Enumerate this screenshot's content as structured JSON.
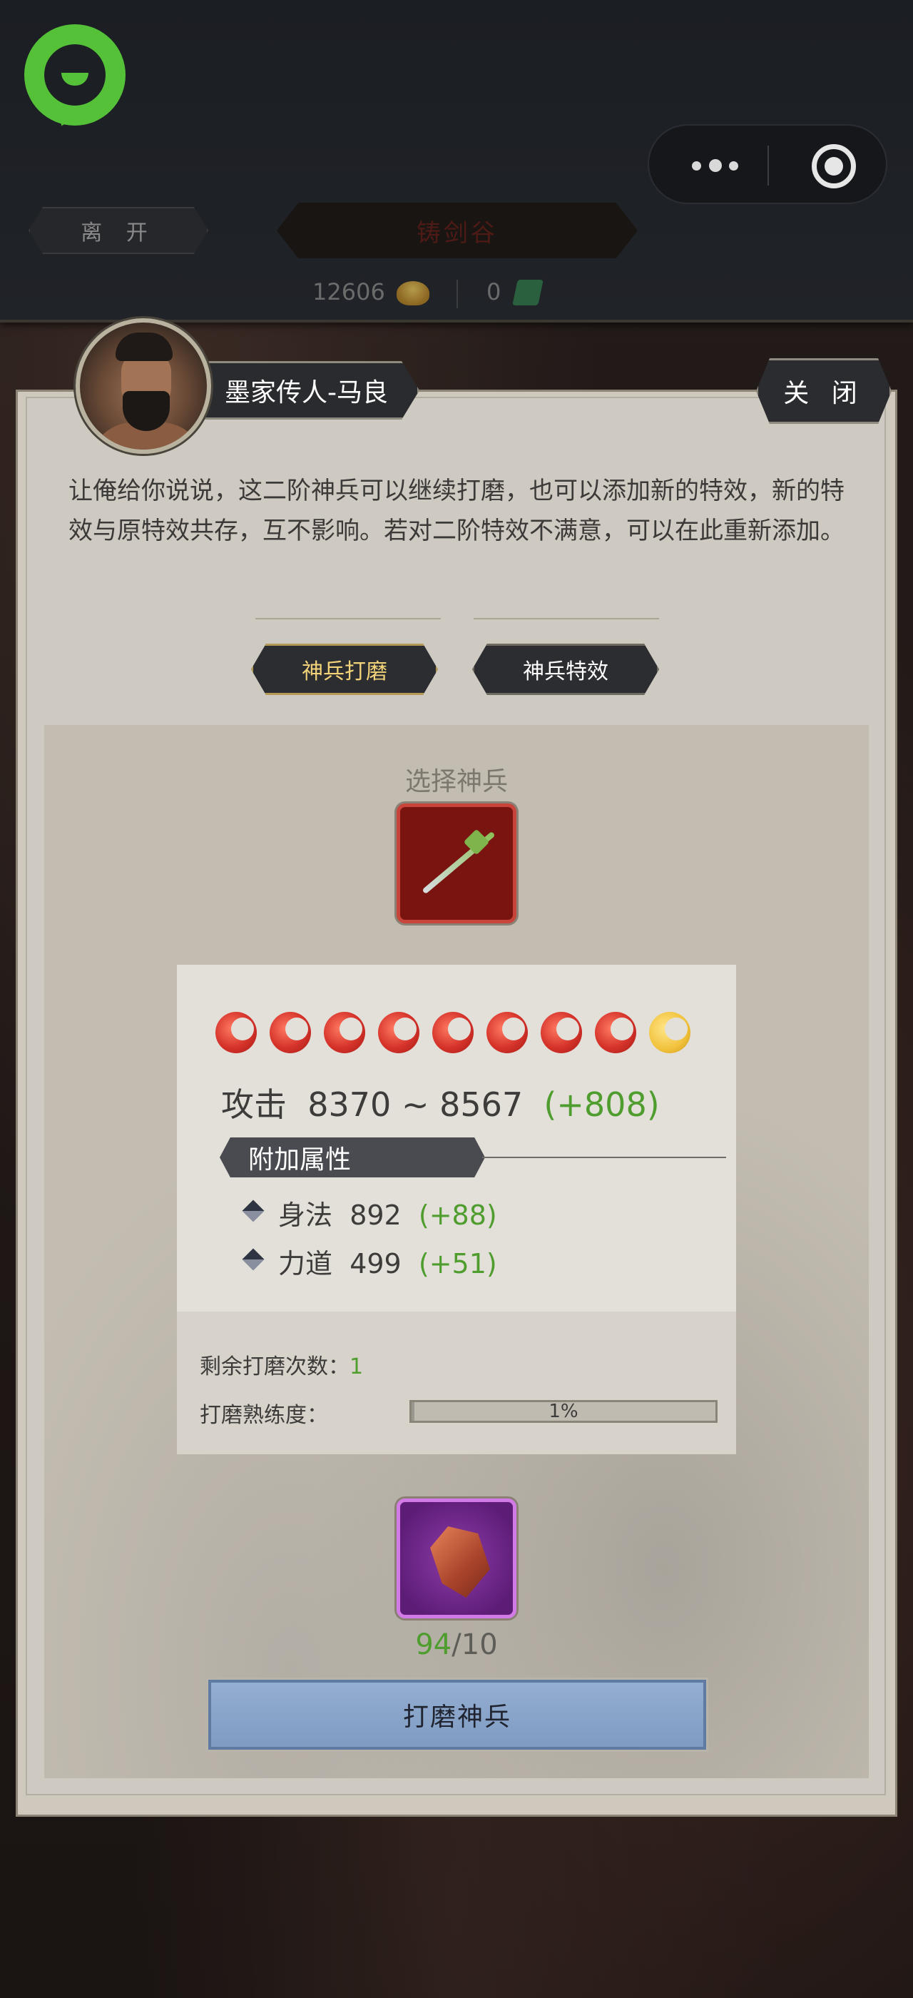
{
  "topbar": {
    "leave_label": "离 开",
    "place_title": "铸剑谷",
    "gold_amount": "12606",
    "jade_amount": "0"
  },
  "npc": {
    "name": "墨家传人-马良",
    "close_label": "关 闭",
    "dialog": "让俺给你说说，这二阶神兵可以继续打磨，也可以添加新的特效，新的特效与原特效共存，互不影响。若对二阶特效不满意，可以在此重新添加。"
  },
  "tabs": [
    {
      "label": "神兵打磨",
      "active": true
    },
    {
      "label": "神兵特效",
      "active": false
    }
  ],
  "weapon": {
    "select_label": "选择神兵",
    "stars": [
      "sun",
      "sun",
      "sun",
      "sun",
      "sun",
      "sun",
      "sun",
      "sun",
      "moon"
    ],
    "attack_label": "攻击",
    "attack_range": "8370 ~ 8567",
    "attack_bonus": "(+808)",
    "extra_header": "附加属性",
    "attributes": [
      {
        "name": "身法",
        "value": "892",
        "bonus": "(+88)"
      },
      {
        "name": "力道",
        "value": "499",
        "bonus": "(+51)"
      }
    ],
    "remaining_label": "剩余打磨次数：",
    "remaining_value": "1",
    "proficiency_label": "打磨熟练度：",
    "proficiency_text": "1%",
    "proficiency_fraction": 0.01
  },
  "material": {
    "have": "94",
    "need": "/10"
  },
  "grind_button_label": "打磨神兵",
  "colors": {
    "accent_green": "#4f9d2e",
    "logo_green": "#55c138",
    "tab_active_text": "#f2d37a",
    "button_blue": "#8aa6cb",
    "weapon_frame_red": "#c9443a",
    "material_frame_purple": "#d27ae8"
  },
  "icons": {
    "logo": "chat-bubble-icon",
    "more": "more-dots-icon",
    "capsule": "target-icon",
    "gold": "gold-ingot-icon",
    "jade": "jade-icon",
    "star": "sun-star-icon",
    "moon": "moon-star-icon",
    "attr": "diamond-bullet-icon"
  }
}
